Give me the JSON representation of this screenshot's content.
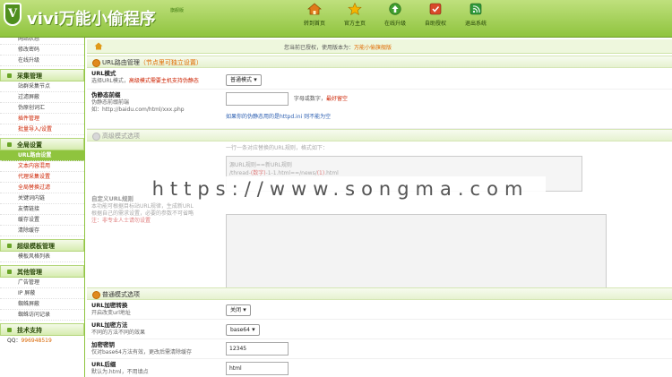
{
  "app": {
    "logo_letter": "V",
    "title": "vivi万能小偷程序",
    "version": "旗舰版"
  },
  "nav": [
    {
      "label": "转到首页",
      "icon": "home-icon"
    },
    {
      "label": "官方主页",
      "icon": "star-icon"
    },
    {
      "label": "在线升级",
      "icon": "upgrade-arrow-icon"
    },
    {
      "label": "自助授权",
      "icon": "authorize-icon"
    },
    {
      "label": "退出系统",
      "icon": "logout-icon"
    }
  ],
  "subbar": {
    "prefix": "您当前已授权，使用版本为：",
    "version": "万能小偷旗舰版"
  },
  "sidebar": {
    "top_items": [
      "网站状态",
      "修改密码",
      "在线升级"
    ],
    "groups": [
      {
        "title": "采集管理",
        "items": [
          {
            "label": "站群采集节点",
            "style": "normal"
          },
          {
            "label": "过滤屏蔽",
            "style": "normal"
          },
          {
            "label": "伪原创词汇",
            "style": "normal"
          },
          {
            "label": "插件管理",
            "style": "red"
          },
          {
            "label": "批量导入/设置",
            "style": "red"
          }
        ]
      },
      {
        "title": "全局设置",
        "items": [
          {
            "label": "URL路由设置",
            "style": "active"
          },
          {
            "label": "文本内容混用",
            "style": "red"
          },
          {
            "label": "代理采集设置",
            "style": "red"
          },
          {
            "label": "全局替换过滤",
            "style": "red"
          },
          {
            "label": "关键词内链",
            "style": "normal"
          },
          {
            "label": "友情链接",
            "style": "normal"
          },
          {
            "label": "缓存设置",
            "style": "normal"
          },
          {
            "label": "清除缓存",
            "style": "normal"
          }
        ]
      },
      {
        "title": "超级模板管理",
        "items": [
          {
            "label": "模板风格列表",
            "style": "normal"
          }
        ]
      },
      {
        "title": "其他管理",
        "items": [
          {
            "label": "广告管理",
            "style": "normal"
          },
          {
            "label": "IP 屏蔽",
            "style": "normal"
          },
          {
            "label": "蜘蛛屏蔽",
            "style": "normal"
          },
          {
            "label": "蜘蛛访问记录",
            "style": "normal"
          }
        ]
      },
      {
        "title": "技术支持",
        "items": []
      }
    ],
    "qq_label": "QQ：",
    "qq_value": "996948519"
  },
  "sections": {
    "routing": {
      "title": "URL路由管理",
      "note": "（节点里可独立设置）",
      "url_mode": {
        "title": "URL模式",
        "desc": "选择URL模式，",
        "desc_red": "高级模式需要主机支持伪静态",
        "value": "普通模式"
      },
      "static_prefix": {
        "title": "伪静态前缀",
        "desc": "伪静态前缀前端",
        "example": "如：http://baidu.com/html/xxx.php",
        "value": "",
        "hint": "字母或数字，",
        "hint_red": "最好留空",
        "note": "如果你的伪静态用的是httpd.ini 则不能为空"
      }
    },
    "advanced": {
      "title": "高级模式选项",
      "rules_hint": "一行一条对应替换的URL规则，格式如下：",
      "rules_example_1": "源URL规则==新URL规则",
      "rules_example_2_a": "/thread-",
      "rules_example_2_b": "(数字)",
      "rules_example_2_c": "-1-1.html==/news/",
      "rules_example_2_d": "(1)",
      "rules_example_2_e": ".html",
      "custom_title": "自定义URL规则",
      "custom_desc": "本功能可根据目标站URL规律，生成新URL",
      "custom_desc2": "根据自己的需求设置，必要的参数不可省略",
      "custom_note": "注：非专业人士请勿设置"
    },
    "normal": {
      "title": "普通模式选项",
      "encrypt": {
        "title": "URL加密转换",
        "desc": "开启改变url地址",
        "value": "关闭"
      },
      "method": {
        "title": "URL加密方法",
        "desc": "不同的方法不同的效果",
        "value": "base64"
      },
      "key": {
        "title": "加密密钥",
        "desc": "仅对base64方法有效，更改后需清除缓存",
        "value": "12345"
      },
      "suffix": {
        "title": "URL后缀",
        "desc": "默认为.html，不用填点",
        "value": "html"
      }
    }
  },
  "watermark": "https://www.songma.com"
}
